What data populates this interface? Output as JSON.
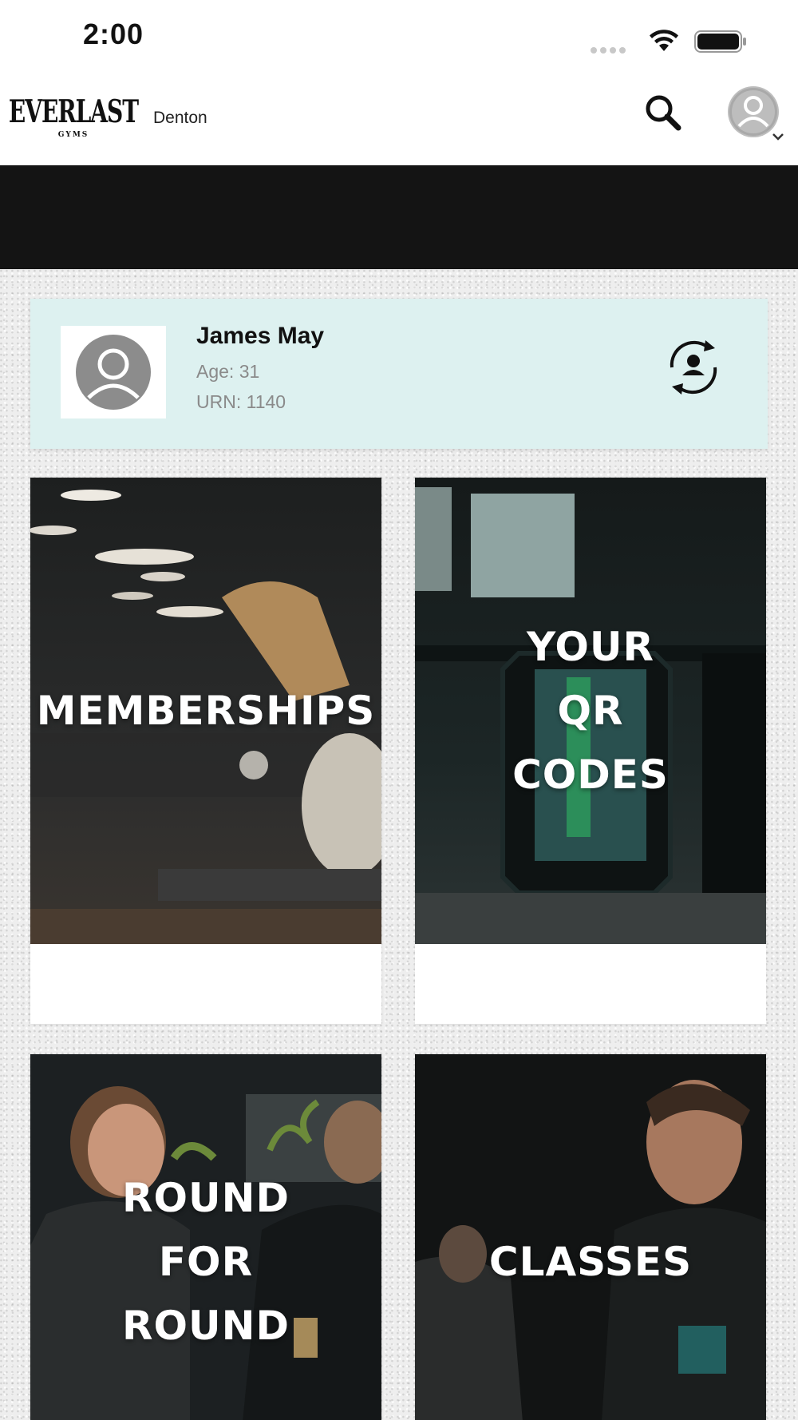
{
  "status_bar": {
    "time": "2:00"
  },
  "header": {
    "logo_text": "EVERLAST",
    "logo_sub": "GYMS",
    "location": "Denton",
    "icons": [
      "search-icon",
      "avatar-icon",
      "chevron-down-icon"
    ]
  },
  "profile": {
    "name": "James May",
    "age": "Age: 31",
    "urn": "URN: 1140",
    "background_color": "#ddf1f0"
  },
  "tiles": [
    {
      "label": "MEMBERSHIPS"
    },
    {
      "label": "YOUR\nQR\nCODES"
    },
    {
      "label": "ROUND\nFOR\nROUND"
    },
    {
      "label": "CLASSES"
    }
  ]
}
